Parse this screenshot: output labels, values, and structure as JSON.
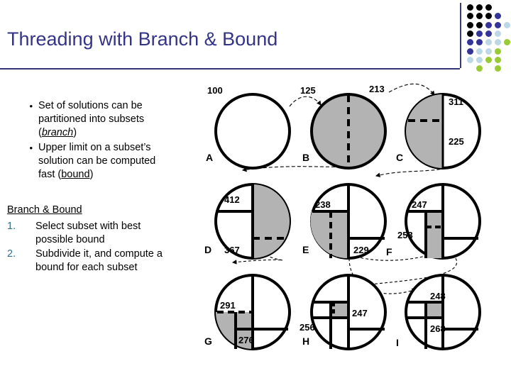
{
  "slide": {
    "title": "Threading with Branch & Bound"
  },
  "logo": {
    "colors": {
      "black": "#000000",
      "navy": "#333399",
      "lightblue": "#bcd7e6",
      "green": "#99cc33"
    },
    "dots": [
      {
        "row": 0,
        "col": 0,
        "color": "#000000"
      },
      {
        "row": 0,
        "col": 1,
        "color": "#000000"
      },
      {
        "row": 0,
        "col": 2,
        "color": "#000000"
      },
      {
        "row": 1,
        "col": 0,
        "color": "#000000"
      },
      {
        "row": 1,
        "col": 1,
        "color": "#000000"
      },
      {
        "row": 1,
        "col": 2,
        "color": "#000000"
      },
      {
        "row": 1,
        "col": 3,
        "color": "#333399"
      },
      {
        "row": 2,
        "col": 0,
        "color": "#000000"
      },
      {
        "row": 2,
        "col": 1,
        "color": "#000000"
      },
      {
        "row": 2,
        "col": 2,
        "color": "#333399"
      },
      {
        "row": 2,
        "col": 3,
        "color": "#333399"
      },
      {
        "row": 2,
        "col": 4,
        "color": "#bcd7e6"
      },
      {
        "row": 3,
        "col": 0,
        "color": "#000000"
      },
      {
        "row": 3,
        "col": 1,
        "color": "#333399"
      },
      {
        "row": 3,
        "col": 2,
        "color": "#333399"
      },
      {
        "row": 3,
        "col": 3,
        "color": "#bcd7e6"
      },
      {
        "row": 4,
        "col": 0,
        "color": "#333399"
      },
      {
        "row": 4,
        "col": 1,
        "color": "#333399"
      },
      {
        "row": 4,
        "col": 2,
        "color": "#bcd7e6"
      },
      {
        "row": 4,
        "col": 3,
        "color": "#bcd7e6"
      },
      {
        "row": 4,
        "col": 4,
        "color": "#99cc33"
      },
      {
        "row": 5,
        "col": 0,
        "color": "#333399"
      },
      {
        "row": 5,
        "col": 1,
        "color": "#bcd7e6"
      },
      {
        "row": 5,
        "col": 2,
        "color": "#bcd7e6"
      },
      {
        "row": 5,
        "col": 3,
        "color": "#99cc33"
      },
      {
        "row": 6,
        "col": 0,
        "color": "#bcd7e6"
      },
      {
        "row": 6,
        "col": 1,
        "color": "#bcd7e6"
      },
      {
        "row": 6,
        "col": 2,
        "color": "#99cc33"
      },
      {
        "row": 6,
        "col": 3,
        "color": "#99cc33"
      },
      {
        "row": 7,
        "col": 1,
        "color": "#99cc33"
      },
      {
        "row": 7,
        "col": 3,
        "color": "#99cc33"
      }
    ]
  },
  "bullets": [
    {
      "marker": "•",
      "lines": [
        "Set of solutions can be",
        "partitioned into subsets",
        "(branch)"
      ],
      "emphasis": "branch"
    },
    {
      "marker": "•",
      "lines": [
        "Upper limit on a subset’s",
        "solution can be computed",
        "fast (bound)"
      ],
      "emphasis": "bound"
    }
  ],
  "section": {
    "heading": "Branch & Bound",
    "items": [
      {
        "number": "1.",
        "lines": [
          "Select subset with best",
          "possible bound"
        ]
      },
      {
        "number": "2.",
        "lines": [
          "Subdivide it, and compute a",
          "bound for each subset"
        ]
      }
    ]
  },
  "figure": {
    "caption_labels": [
      "A",
      "B",
      "C",
      "D",
      "E",
      "F",
      "G",
      "H",
      "I"
    ],
    "fill_gray": "#b3b3b3",
    "stroke": "#000000",
    "nodes": [
      {
        "id": "A",
        "label": "A",
        "values": [
          "100"
        ],
        "shaded": false,
        "dashed_split": false
      },
      {
        "id": "B",
        "label": "B",
        "values": [
          "125",
          "213"
        ],
        "shaded": true,
        "dashed_split": true
      },
      {
        "id": "C",
        "label": "C",
        "values": [
          "311",
          "225"
        ],
        "shaded": true,
        "dashed_split": true
      },
      {
        "id": "D",
        "label": "D",
        "values": [
          "412",
          "367"
        ],
        "shaded": true,
        "dashed_split": true
      },
      {
        "id": "E",
        "label": "E",
        "values": [
          "238",
          "229"
        ],
        "shaded": true,
        "dashed_split": true
      },
      {
        "id": "F",
        "label": "F",
        "values": [
          "247",
          "253"
        ],
        "shaded": true,
        "dashed_split": true
      },
      {
        "id": "G",
        "label": "G",
        "values": [
          "291",
          "276"
        ],
        "shaded": true,
        "dashed_split": true
      },
      {
        "id": "H",
        "label": "H",
        "values": [
          "256",
          "247"
        ],
        "shaded": true,
        "dashed_split": true
      },
      {
        "id": "I",
        "label": "I",
        "values": [
          "248",
          "268"
        ],
        "shaded": true,
        "dashed_split": true
      }
    ],
    "edges": [
      {
        "from": "A",
        "to": "B"
      },
      {
        "from": "B",
        "to": "C"
      },
      {
        "from": "B",
        "to": "D"
      },
      {
        "from": "C",
        "to": "E"
      },
      {
        "from": "D",
        "to": "G"
      },
      {
        "from": "E",
        "to": "F"
      },
      {
        "from": "F",
        "to": "H"
      },
      {
        "from": "E",
        "to": "I"
      }
    ]
  }
}
